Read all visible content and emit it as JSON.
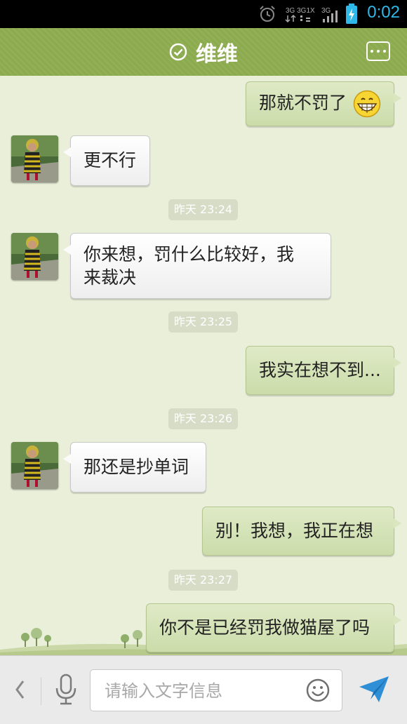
{
  "status_bar": {
    "time": "0:02",
    "network_label": "3G",
    "icons": [
      "alarm-icon",
      "network-3g-icon",
      "signal-icon",
      "battery-charging-icon"
    ]
  },
  "header": {
    "title": "维维",
    "status_icon": "check-circle-icon",
    "menu_icon": "more-options-icon"
  },
  "messages": [
    {
      "side": "out",
      "text": "那就不罚了",
      "emoji": "grin-emoji-icon"
    },
    {
      "side": "in",
      "text": "更不行"
    },
    {
      "type": "time",
      "text": "昨天 23:24"
    },
    {
      "side": "in",
      "text": "你来想，罚什么比较好，我来裁决"
    },
    {
      "type": "time",
      "text": "昨天 23:25"
    },
    {
      "side": "out",
      "text": "我实在想不到..."
    },
    {
      "type": "time",
      "text": "昨天 23:26"
    },
    {
      "side": "in",
      "text": "那还是抄单词"
    },
    {
      "side": "out",
      "text": "别！我想，我正在想"
    },
    {
      "type": "time",
      "text": "昨天 23:27"
    },
    {
      "side": "out",
      "text": "你不是已经罚我做猫屋了吗"
    }
  ],
  "input_bar": {
    "placeholder": "请输入文字信息",
    "value": "",
    "icons": [
      "back-chevron-icon",
      "microphone-icon",
      "smiley-icon",
      "send-icon"
    ]
  },
  "colors": {
    "header_green": "#8cab4e",
    "chat_bg": "#e9efd9",
    "outgoing_bubble": "#d4e3b5",
    "incoming_bubble": "#ffffff",
    "time_accent": "#2fb8e8"
  }
}
